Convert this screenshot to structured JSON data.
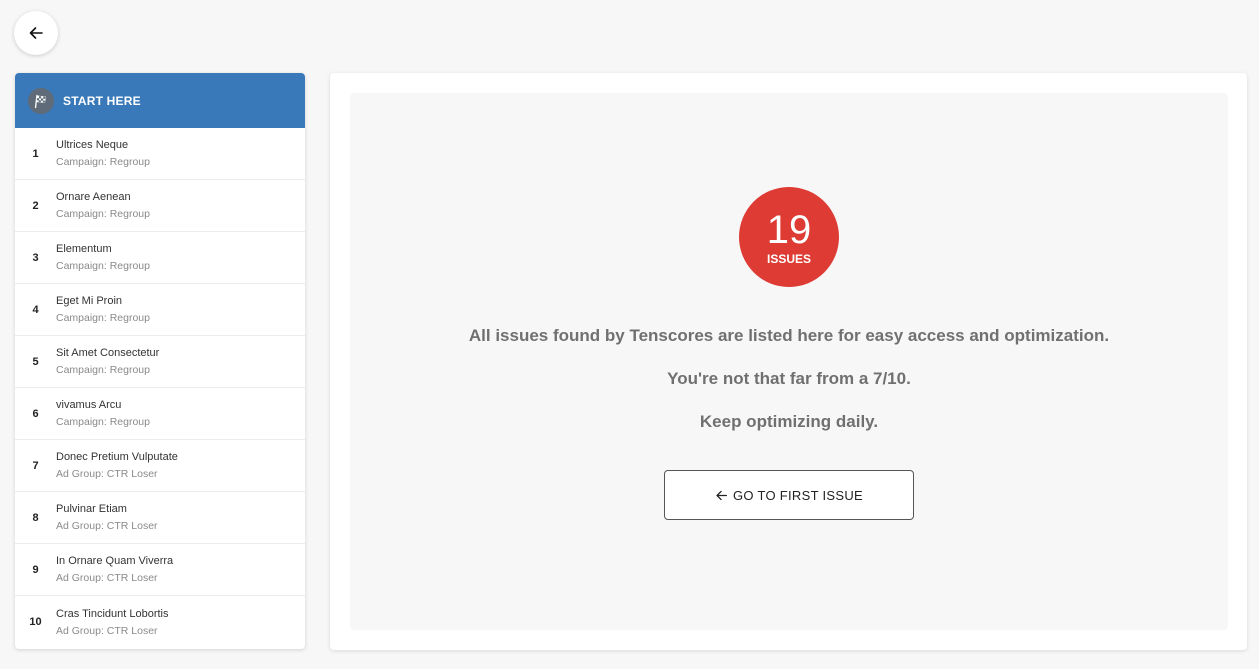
{
  "sidebar": {
    "header_label": "START HERE",
    "items": [
      {
        "num": "1",
        "title": "Ultrices Neque",
        "subtitle": "Campaign: Regroup"
      },
      {
        "num": "2",
        "title": "Ornare Aenean",
        "subtitle": "Campaign: Regroup"
      },
      {
        "num": "3",
        "title": "Elementum",
        "subtitle": "Campaign: Regroup"
      },
      {
        "num": "4",
        "title": "Eget Mi Proin",
        "subtitle": "Campaign: Regroup"
      },
      {
        "num": "5",
        "title": "Sit Amet Consectetur",
        "subtitle": "Campaign: Regroup"
      },
      {
        "num": "6",
        "title": "vivamus Arcu",
        "subtitle": "Campaign: Regroup"
      },
      {
        "num": "7",
        "title": "Donec Pretium Vulputate",
        "subtitle": "Ad Group: CTR Loser"
      },
      {
        "num": "8",
        "title": "Pulvinar Etiam",
        "subtitle": "Ad Group: CTR Loser"
      },
      {
        "num": "9",
        "title": "In Ornare Quam Viverra",
        "subtitle": "Ad Group: CTR Loser"
      },
      {
        "num": "10",
        "title": "Cras Tincidunt Lobortis",
        "subtitle": "Ad Group: CTR Loser"
      }
    ]
  },
  "main": {
    "badge": {
      "count": "19",
      "label": "ISSUES"
    },
    "message_line1": "All issues found by Tenscores are listed here for easy access and optimization.",
    "message_line2": "You're not that far from a 7/10.",
    "message_line3": "Keep optimizing daily.",
    "button_label": "GO TO FIRST ISSUE"
  },
  "colors": {
    "header_blue": "#3a79b9",
    "badge_red": "#dd3b34",
    "page_bg": "#f7f7f7"
  },
  "icons": {
    "back": "arrow-left-icon",
    "header": "checkered-flag-icon",
    "button": "arrow-left-icon"
  }
}
